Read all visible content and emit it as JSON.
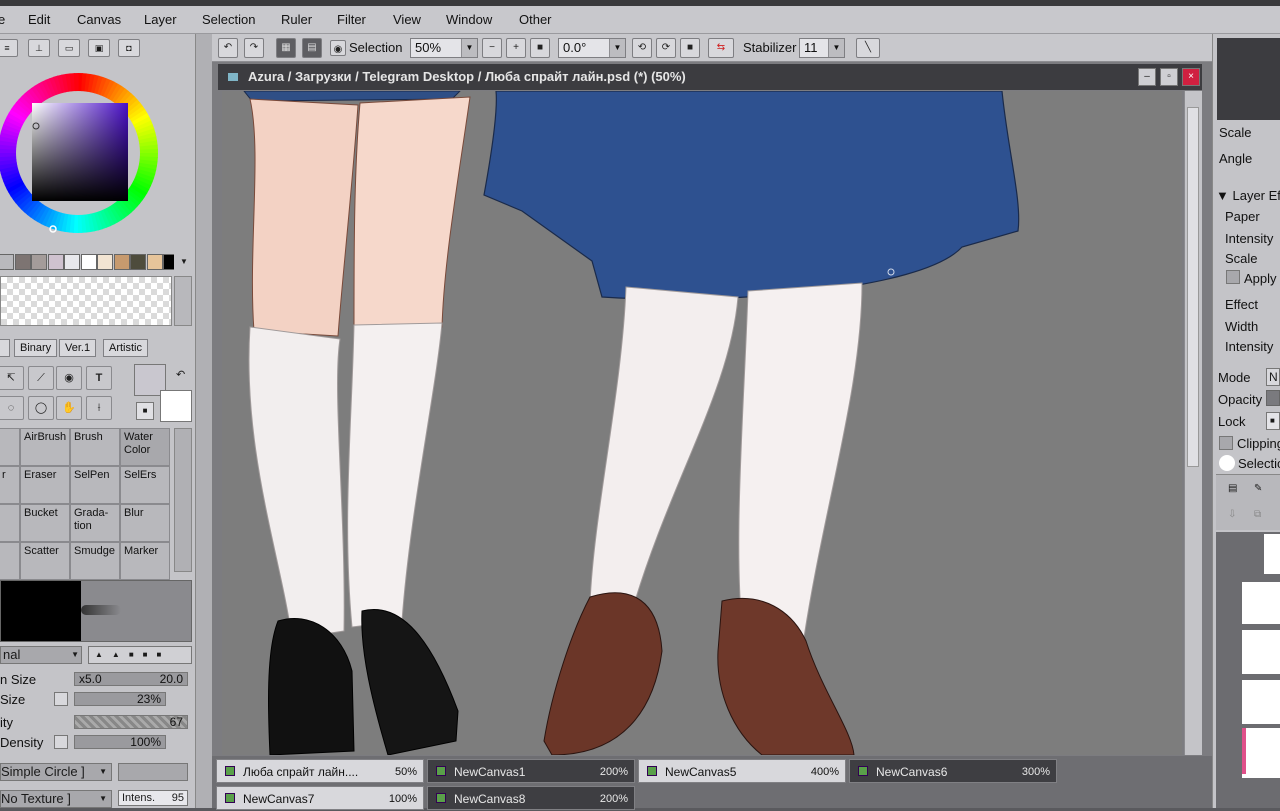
{
  "menu": [
    "e",
    "Edit",
    "Canvas",
    "Layer",
    "Selection",
    "Ruler",
    "Filter",
    "View",
    "Window",
    "Other"
  ],
  "toolbar": {
    "selection_label": "Selection",
    "zoom_value": "50%",
    "rotation_value": "0.0°",
    "stabilizer_label": "Stabilizer",
    "stabilizer_value": "11"
  },
  "canvas": {
    "title": "Azura / Загрузки / Telegram Desktop / Люба спрайт лайн.psd (*) (50%)"
  },
  "left_panel": {
    "swatch_colors": [
      "#b9b9bd",
      "#7d7472",
      "#a49c9a",
      "#cfc2cf",
      "#e8e8ec",
      "#ffffff",
      "#f2e4d2",
      "#c79a6e",
      "#4e4c3c",
      "#e6c49a",
      "#000000"
    ],
    "tabs": [
      "Binary",
      "Ver.1",
      "Artistic"
    ],
    "tools_row1": [
      "↸",
      "⟋",
      "◉",
      "T"
    ],
    "tools_row2": [
      "◌",
      "◯",
      "✋",
      "⟊"
    ],
    "brushes": [
      [
        "",
        "AirBrush",
        "Brush",
        "Water Color"
      ],
      [
        "r",
        "Eraser",
        "SelPen",
        "SelErs"
      ],
      [
        "",
        "Bucket",
        "Grada-tion",
        "Blur"
      ],
      [
        "",
        "Scatter",
        "Smudge",
        "Marker"
      ]
    ],
    "blend_mode": "nal",
    "props": [
      {
        "label": "n Size",
        "value": "20.0",
        "mult": "x5.0"
      },
      {
        "label": "Size",
        "value": "23%"
      },
      {
        "label": "ity",
        "value": "67"
      },
      {
        "label": "Density",
        "value": "100%"
      }
    ],
    "shape": "Simple Circle ]",
    "texture": "No Texture ]",
    "intensity_label": "Intens.",
    "intensity_value": "95"
  },
  "right_panel": {
    "scale_label": "Scale",
    "angle_label": "Angle",
    "layer_effects": "Layer Effe",
    "paper": "Paper",
    "intensity1": "Intensity",
    "scale2": "Scale",
    "apply": "Apply",
    "effect": "Effect",
    "width": "Width",
    "intensity2": "Intensity",
    "mode": "Mode",
    "mode_value": "N",
    "opacity": "Opacity",
    "lock": "Lock",
    "clipping": "Clipping",
    "selection": "Selectio"
  },
  "doc_tabs": [
    {
      "name": "Люба спрайт лайн....",
      "zoom": "50%",
      "active": false
    },
    {
      "name": "NewCanvas1",
      "zoom": "200%",
      "active": true
    },
    {
      "name": "NewCanvas5",
      "zoom": "400%",
      "active": false
    },
    {
      "name": "NewCanvas6",
      "zoom": "300%",
      "active": true
    },
    {
      "name": "NewCanvas7",
      "zoom": "100%",
      "active": false
    },
    {
      "name": "NewCanvas8",
      "zoom": "200%",
      "active": true
    }
  ]
}
